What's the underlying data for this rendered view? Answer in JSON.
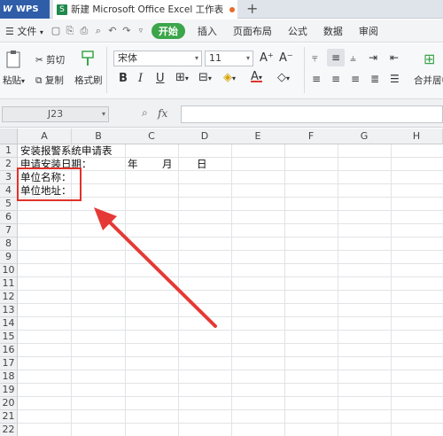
{
  "titlebar": {
    "app_name": "WPS",
    "doc_tab_title": "新建 Microsoft Office Excel 工作表",
    "new_tab_symbol": "+"
  },
  "menubar": {
    "file_label": "文件",
    "start_label": "开始",
    "items": [
      "插入",
      "页面布局",
      "公式",
      "数据",
      "审阅"
    ]
  },
  "ribbon": {
    "paste_label": "粘贴",
    "cut_label": "剪切",
    "copy_label": "复制",
    "format_painter_label": "格式刷",
    "font_name": "宋体",
    "font_size": "11",
    "bold": "B",
    "italic": "I",
    "underline": "U",
    "grow_font": "A⁺",
    "shrink_font": "A⁻",
    "merge_center_label": "合并居中"
  },
  "formulabar": {
    "name_box": "J23",
    "fx_label": "fx"
  },
  "sheet": {
    "columns": [
      "A",
      "B",
      "C",
      "D",
      "E",
      "F",
      "G",
      "H"
    ],
    "rows": [
      "1",
      "2",
      "3",
      "4",
      "5",
      "6",
      "7",
      "8",
      "9",
      "10",
      "11",
      "12",
      "13",
      "14",
      "15",
      "16",
      "17",
      "18",
      "19",
      "20",
      "21",
      "22"
    ],
    "cells": {
      "A1": "安装报警系统申请表",
      "A2": "申请安装日期：",
      "C2": "年",
      "C2b": "月",
      "D2": "日",
      "A3": "单位名称：",
      "A4": "单位地址："
    }
  },
  "annotation": {
    "box_color": "#e0322a",
    "arrow_color": "#e53935"
  },
  "colors": {
    "accent_green": "#3ba54a",
    "wps_blue": "#2f5da8"
  }
}
